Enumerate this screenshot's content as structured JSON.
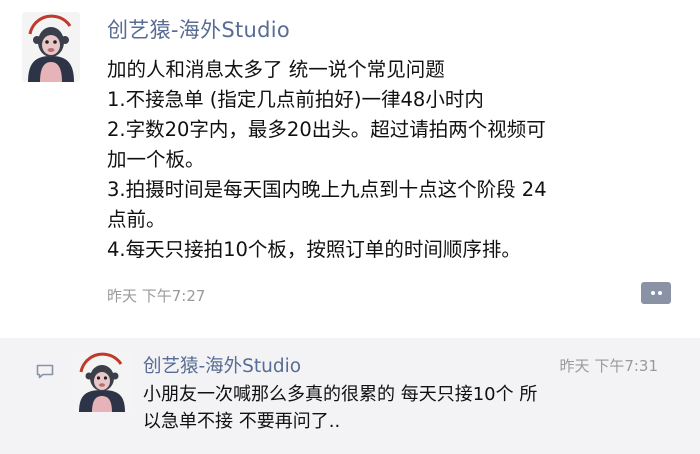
{
  "post": {
    "author": "创艺猿-海外Studio",
    "lines": [
      "加的人和消息太多了 统一说个常见问题",
      "1.不接急单 (指定几点前拍好)一律48小时内",
      "2.字数20字内，最多20出头。超过请拍两个视频可",
      "加一个板。",
      "3.拍摄时间是每天国内晚上九点到十点这个阶段 24",
      "点前。",
      "4.每天只接拍10个板，按照订单的时间顺序排。"
    ],
    "time": "昨天 下午7:27"
  },
  "comment": {
    "author": "创艺猿-海外Studio",
    "time": "昨天 下午7:31",
    "lines": [
      "小朋友一次喊那么多真的很累的 每天只接10个 所",
      "以急单不接 不要再问了.."
    ]
  },
  "icons": {
    "avatar": "monkey-avatar-icon",
    "comment_button": "comment-more-icon",
    "comment_section": "comment-bubble-icon"
  },
  "colors": {
    "name": "#586c94",
    "text": "#111111",
    "time": "#9a9a9a",
    "comment_bg": "#f3f3f5",
    "comment_button": "#8a93a6"
  }
}
